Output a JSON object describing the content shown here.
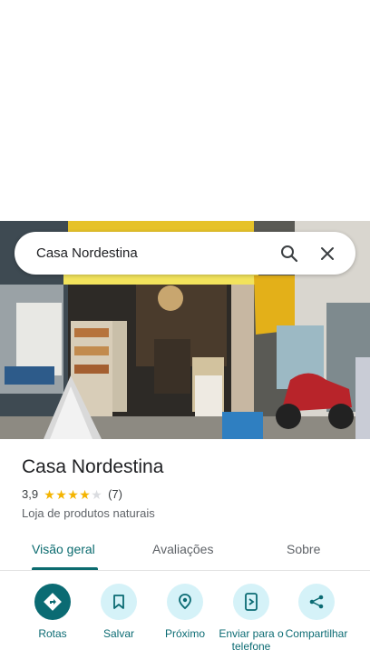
{
  "search": {
    "query": "Casa Nordestina"
  },
  "place": {
    "name": "Casa Nordestina",
    "rating": "3,9",
    "stars": 4,
    "reviews": "(7)",
    "category": "Loja de produtos naturais"
  },
  "tabs": [
    {
      "label": "Visão geral",
      "active": true
    },
    {
      "label": "Avaliações",
      "active": false
    },
    {
      "label": "Sobre",
      "active": false
    }
  ],
  "actions": [
    {
      "label": "Rotas",
      "icon": "directions-icon"
    },
    {
      "label": "Salvar",
      "icon": "bookmark-icon"
    },
    {
      "label": "Próximo",
      "icon": "nearby-icon"
    },
    {
      "label": "Enviar para o telefone",
      "icon": "send-to-phone-icon"
    },
    {
      "label": "Compartilhar",
      "icon": "share-icon"
    }
  ],
  "colors": {
    "accent": "#0b6b73",
    "action_bg": "#d5f2f8",
    "star": "#f4b400"
  }
}
